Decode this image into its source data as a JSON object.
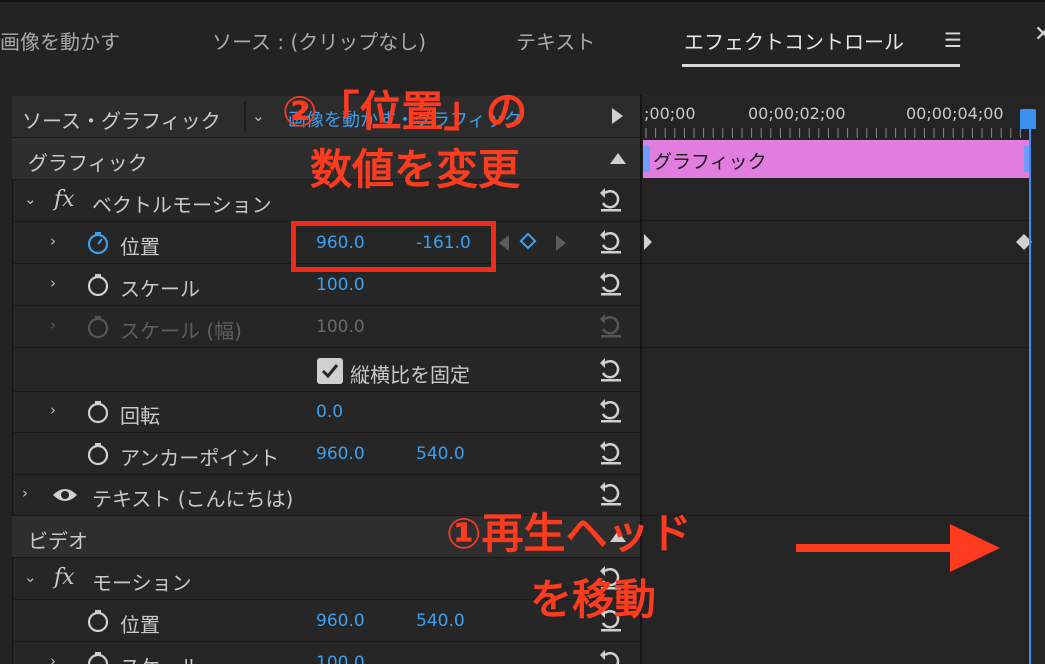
{
  "tabs": [
    {
      "label": "画像を動かす"
    },
    {
      "label": "ソース : (クリップなし)"
    },
    {
      "label": "テキスト"
    },
    {
      "label": "エフェクトコントロール"
    }
  ],
  "source_bar": {
    "label": "ソース・グラフィック",
    "target": "画像を動かす・グラフィック"
  },
  "sections": {
    "graphic": "グラフィック",
    "video": "ビデオ"
  },
  "vector_motion": {
    "title": "ベクトルモーション",
    "position": {
      "label": "位置",
      "x": "960.0",
      "y": "-161.0"
    },
    "scale": {
      "label": "スケール",
      "value": "100.0"
    },
    "scale_width": {
      "label": "スケール (幅)",
      "value": "100.0"
    },
    "aspect": {
      "label": "縦横比を固定",
      "checked": true
    },
    "rotation": {
      "label": "回転",
      "value": "0.0"
    },
    "anchor": {
      "label": "アンカーポイント",
      "x": "960.0",
      "y": "540.0"
    }
  },
  "text_layer": {
    "label": "テキスト (こんにちは)"
  },
  "motion": {
    "title": "モーション",
    "position": {
      "label": "位置",
      "x": "960.0",
      "y": "540.0"
    },
    "scale": {
      "label": "スケール",
      "value": "100.0"
    }
  },
  "timeline": {
    "times": [
      ";00;00",
      "00;00;02;00",
      "00;00;04;00"
    ],
    "clip_label": "グラフィック"
  },
  "annotations": {
    "step2_line1": "②「位置」の",
    "step2_line2": "数値を変更",
    "step1_line1": "①再生ヘッド",
    "step1_line2": "を移動"
  },
  "colors": {
    "accent_blue": "#3aa0f0",
    "clip_pink": "#e27de0",
    "annotation_red": "#ff3b1f"
  }
}
